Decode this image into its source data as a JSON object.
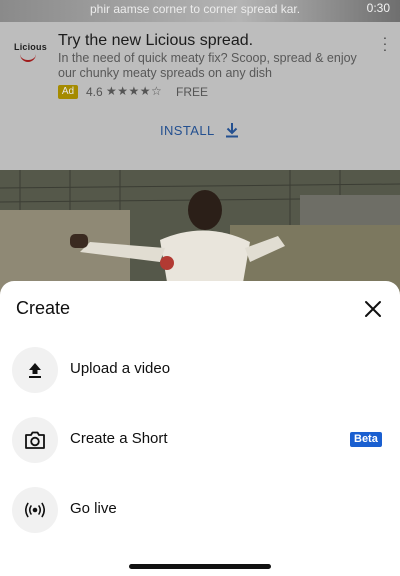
{
  "video": {
    "caption": "phir aamse corner to corner spread kar.",
    "time": "0:30"
  },
  "ad": {
    "logo_text": "Licious",
    "title": "Try the new Licious spread.",
    "description": "In the need of quick meaty fix? Scoop, spread & enjoy our chunky meaty spreads on any dish",
    "badge": "Ad",
    "rating": "4.6",
    "stars": "★★★★☆",
    "price": "FREE",
    "install_label": "INSTALL",
    "menu_icon": "more-vert-icon"
  },
  "sheet": {
    "title": "Create",
    "close_icon": "close-icon",
    "items": [
      {
        "label": "Upload a video",
        "icon": "upload-icon"
      },
      {
        "label": "Create a Short",
        "icon": "camera-icon",
        "badge": "Beta"
      },
      {
        "label": "Go live",
        "icon": "live-broadcast-icon"
      }
    ]
  },
  "colors": {
    "install_blue": "#245090",
    "beta_blue": "#1a5fd0",
    "ad_badge": "#a58b00"
  }
}
